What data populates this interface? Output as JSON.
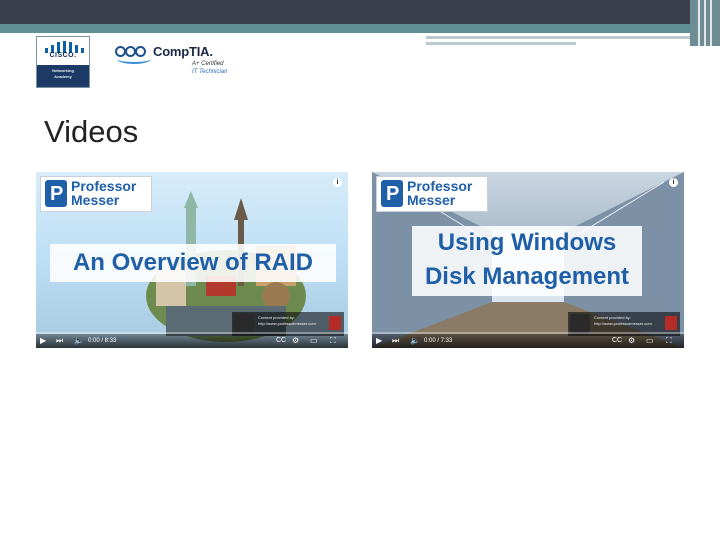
{
  "slide": {
    "title": "Videos"
  },
  "logos": {
    "cisco": {
      "word": "CISCO.",
      "sub_line1": "Networking",
      "sub_line2": "Academy"
    },
    "comptia": {
      "word": "CompTIA.",
      "cert": "A+ Certified",
      "tech": "IT Technician"
    }
  },
  "videos": [
    {
      "brand_line1": "Professor",
      "brand_line2": "Messer",
      "title_line1": "An Overview of RAID",
      "title_line2": "",
      "credit_line1": "Content provided by:",
      "credit_line2": "http://www.professormesser.com",
      "time": "0:00 / 8:33"
    },
    {
      "brand_line1": "Professor",
      "brand_line2": "Messer",
      "title_line1": "Using Windows",
      "title_line2": "Disk Management",
      "credit_line1": "Content provided by:",
      "credit_line2": "http://www.professormesser.com",
      "time": "0:00 / 7:33"
    }
  ],
  "colors": {
    "accent": "#1f5fa8",
    "topbar": "#3a3f4b",
    "teal": "#5e8f95"
  },
  "icons": {
    "play": "play-icon",
    "next": "next-icon",
    "volume": "volume-icon",
    "captions": "captions-icon",
    "settings": "settings-icon",
    "theater": "theater-icon",
    "fullscreen": "fullscreen-icon",
    "info": "info-icon"
  }
}
